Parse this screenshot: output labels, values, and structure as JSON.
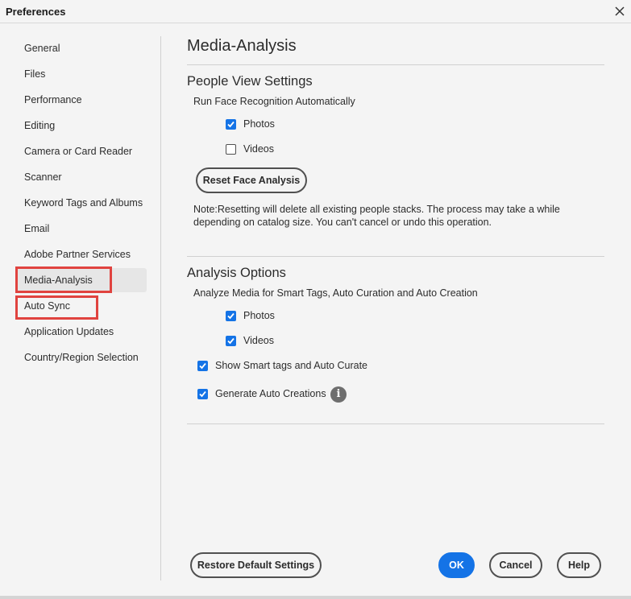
{
  "window": {
    "title": "Preferences",
    "close_icon": "close-icon"
  },
  "sidebar": {
    "items": [
      {
        "label": "General"
      },
      {
        "label": "Files"
      },
      {
        "label": "Performance"
      },
      {
        "label": "Editing"
      },
      {
        "label": "Camera or Card Reader"
      },
      {
        "label": "Scanner"
      },
      {
        "label": "Keyword Tags and Albums"
      },
      {
        "label": "Email"
      },
      {
        "label": "Adobe Partner Services"
      },
      {
        "label": "Media-Analysis",
        "selected": true
      },
      {
        "label": "Auto Sync"
      },
      {
        "label": "Application Updates"
      },
      {
        "label": "Country/Region Selection"
      }
    ]
  },
  "main": {
    "title": "Media-Analysis",
    "people_view": {
      "heading": "People View Settings",
      "subheading": "Run Face Recognition Automatically",
      "photos": {
        "label": "Photos",
        "checked": true
      },
      "videos": {
        "label": "Videos",
        "checked": false
      },
      "reset_button": "Reset Face Analysis",
      "note": "Note:Resetting will delete all existing people stacks. The process may take a while depending on catalog size. You can't cancel or undo this operation."
    },
    "analysis_options": {
      "heading": "Analysis Options",
      "subheading": "Analyze Media for Smart Tags, Auto Curation and Auto Creation",
      "photos": {
        "label": "Photos",
        "checked": true
      },
      "videos": {
        "label": "Videos",
        "checked": true
      },
      "smart_tags": {
        "label": "Show Smart tags and Auto Curate",
        "checked": true
      },
      "auto_creations": {
        "label": "Generate Auto Creations",
        "checked": true
      },
      "info_icon": "info-icon",
      "info_glyph": "i"
    }
  },
  "footer": {
    "restore_button": "Restore Default Settings",
    "ok_button": "OK",
    "cancel_button": "Cancel",
    "help_button": "Help"
  },
  "colors": {
    "accent": "#1473e6",
    "highlight_annotation": "#e0433f"
  }
}
